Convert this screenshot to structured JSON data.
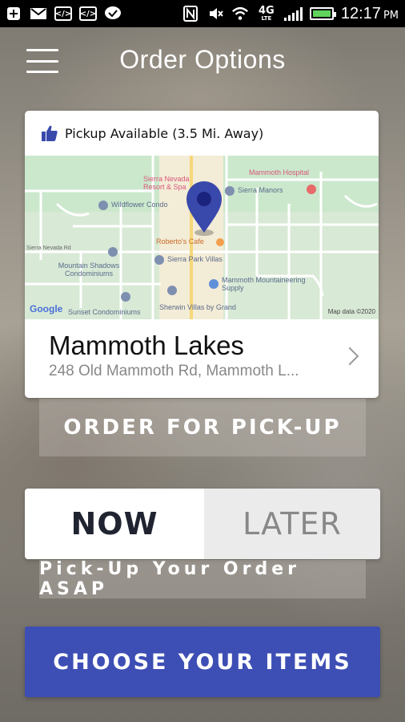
{
  "status_bar": {
    "time": "12:17",
    "ampm": "PM",
    "network": "4G",
    "network_sub": "LTE"
  },
  "header": {
    "title": "Order Options"
  },
  "location_card": {
    "pickup_status": "Pickup Available (3.5 Mi. Away)",
    "store_name": "Mammoth Lakes",
    "store_address": "248 Old Mammoth Rd, Mammoth L...",
    "map": {
      "labels": {
        "sierra_nevada": "Sierra Nevada Resort & Spa",
        "mammoth_hospital": "Mammoth Hospital",
        "sierra_manors": "Sierra Manors",
        "wildflower": "Wildflower Condo",
        "robertos": "Roberto's Cafe",
        "sierra_park": "Sierra Park Villas",
        "mountain_shadows": "Mountain Shadows Condominiums",
        "mammoth_supply": "Mammoth Mountaineering Supply",
        "sunset": "Sunset Condominiums",
        "sherwin": "Sherwin Villas by Grand",
        "google": "Google",
        "map_data": "Map data ©2020",
        "sierra_nevada_rd": "Sierra Nevada Rd"
      }
    }
  },
  "order_mode": {
    "label": "ORDER FOR PICK-UP"
  },
  "timing_toggle": {
    "now": "NOW",
    "later": "LATER",
    "selected": "now"
  },
  "timing_note": "Pick-Up Your Order ASAP",
  "cta": {
    "label": "CHOOSE YOUR ITEMS"
  },
  "colors": {
    "accent": "#3d4eb4",
    "pin": "#3949ab",
    "battery": "#5fd35b"
  }
}
